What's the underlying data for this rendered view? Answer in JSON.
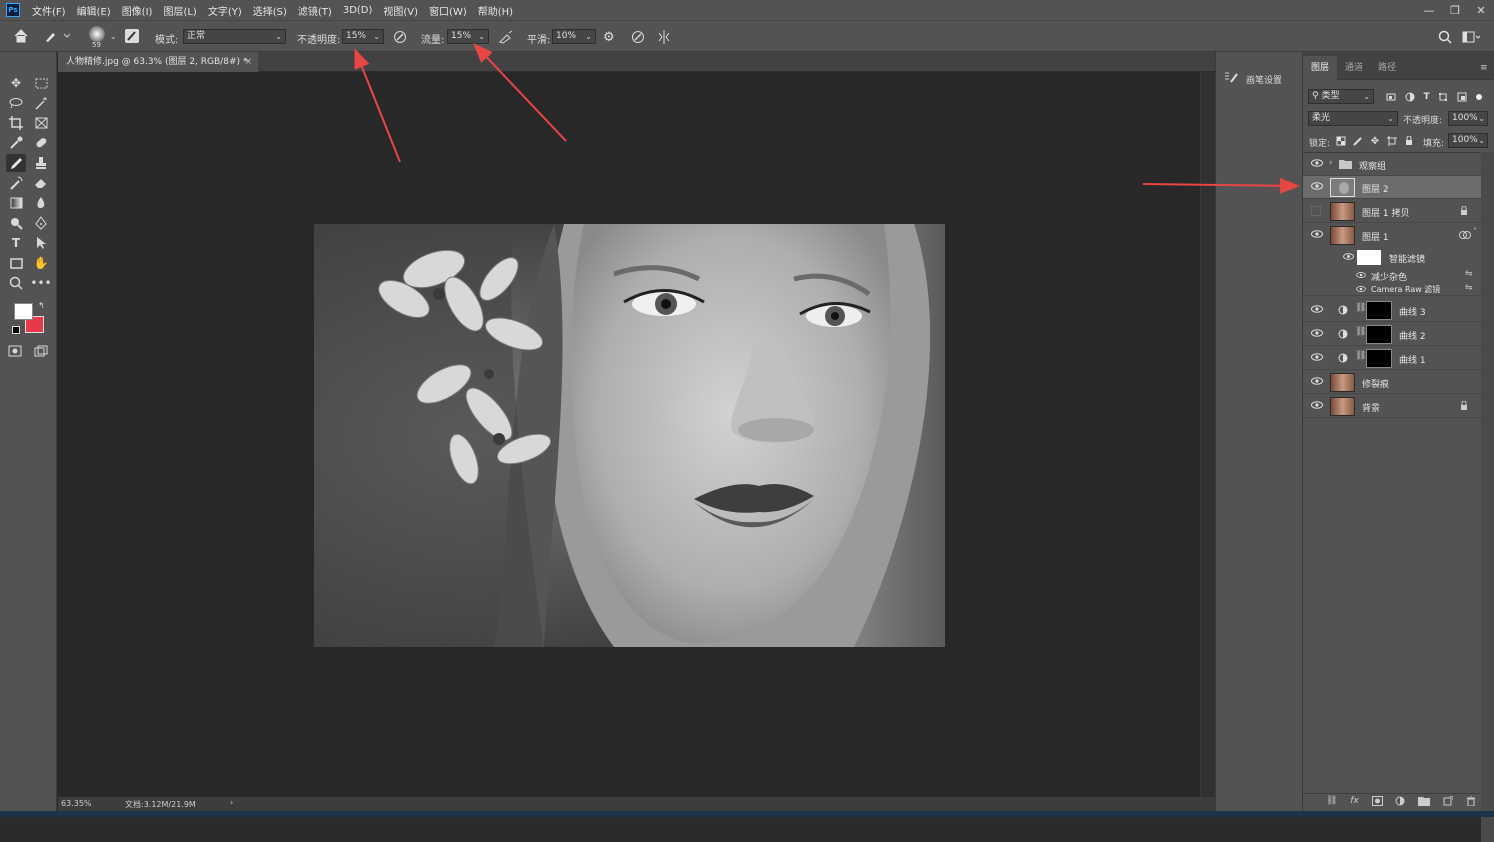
{
  "menubar": {
    "logo": "Ps",
    "items": [
      "文件(F)",
      "编辑(E)",
      "图像(I)",
      "图层(L)",
      "文字(Y)",
      "选择(S)",
      "滤镜(T)",
      "3D(D)",
      "视图(V)",
      "窗口(W)",
      "帮助(H)"
    ],
    "minimize": "—",
    "restore": "❐",
    "close": "✕"
  },
  "options": {
    "brush_size": "59",
    "mode_label": "模式:",
    "mode_value": "正常",
    "opacity_label": "不透明度:",
    "opacity_value": "15%",
    "flow_label": "流量:",
    "flow_value": "15%",
    "smooth_label": "平滑:",
    "smooth_value": "10%"
  },
  "document": {
    "tab_title": "人物精修.jpg @ 63.3% (图层 2, RGB/8#) *",
    "tab_close": "×",
    "zoom": "63.35%",
    "doc_size": "文档:3.12M/21.9M",
    "status_arrow": "›"
  },
  "brush_settings_label": "画笔设置",
  "layers_panel": {
    "tabs": [
      "图层",
      "通道",
      "路径"
    ],
    "filter_kind": "类型",
    "blend_mode": "柔光",
    "opacity_label": "不透明度:",
    "opacity_value": "100%",
    "lock_label": "锁定:",
    "fill_label": "填充:",
    "fill_value": "100%",
    "layers": [
      {
        "name": "观察组"
      },
      {
        "name": "图层 2"
      },
      {
        "name": "图层 1 拷贝"
      },
      {
        "name": "图层 1"
      },
      {
        "name": "智能滤镜"
      },
      {
        "name": "减少杂色"
      },
      {
        "name": "Camera Raw 滤镜"
      },
      {
        "name": "曲线 3"
      },
      {
        "name": "曲线 2"
      },
      {
        "name": "曲线 1"
      },
      {
        "name": "修裂痕"
      },
      {
        "name": "背景"
      }
    ],
    "fx_label": "fx"
  },
  "colors": {
    "foreground": "#ffffff",
    "background": "#e8384a",
    "annotation_arrow": "#e84545"
  }
}
